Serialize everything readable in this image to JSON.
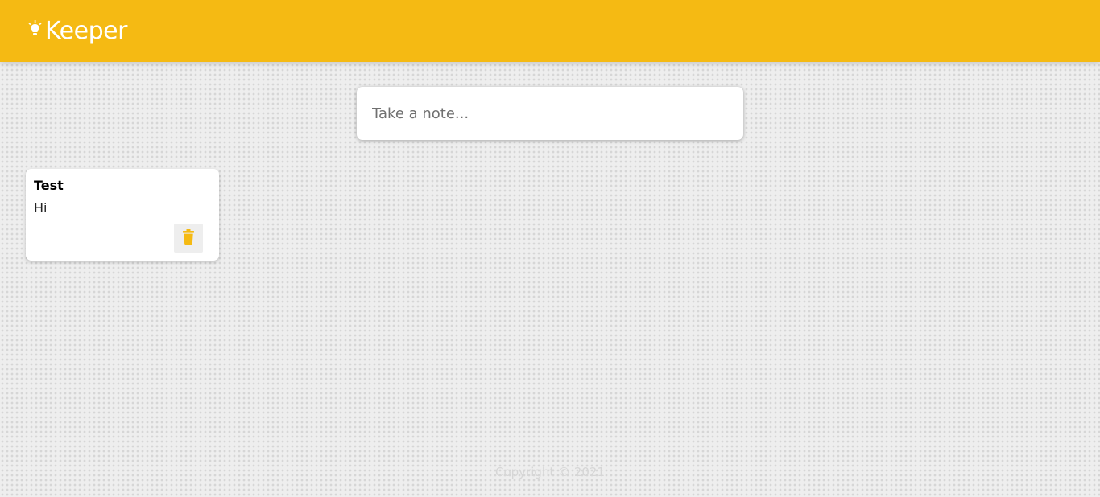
{
  "app": {
    "title": "Keeper",
    "accent_color": "#f5ba13",
    "logo_icon": "lightbulb-icon"
  },
  "create_area": {
    "placeholder": "Take a note...",
    "value": ""
  },
  "notes": [
    {
      "title": "Test",
      "content": "Hi",
      "delete_icon": "trash-icon"
    }
  ],
  "footer": {
    "text": "Copyright © 2021"
  }
}
